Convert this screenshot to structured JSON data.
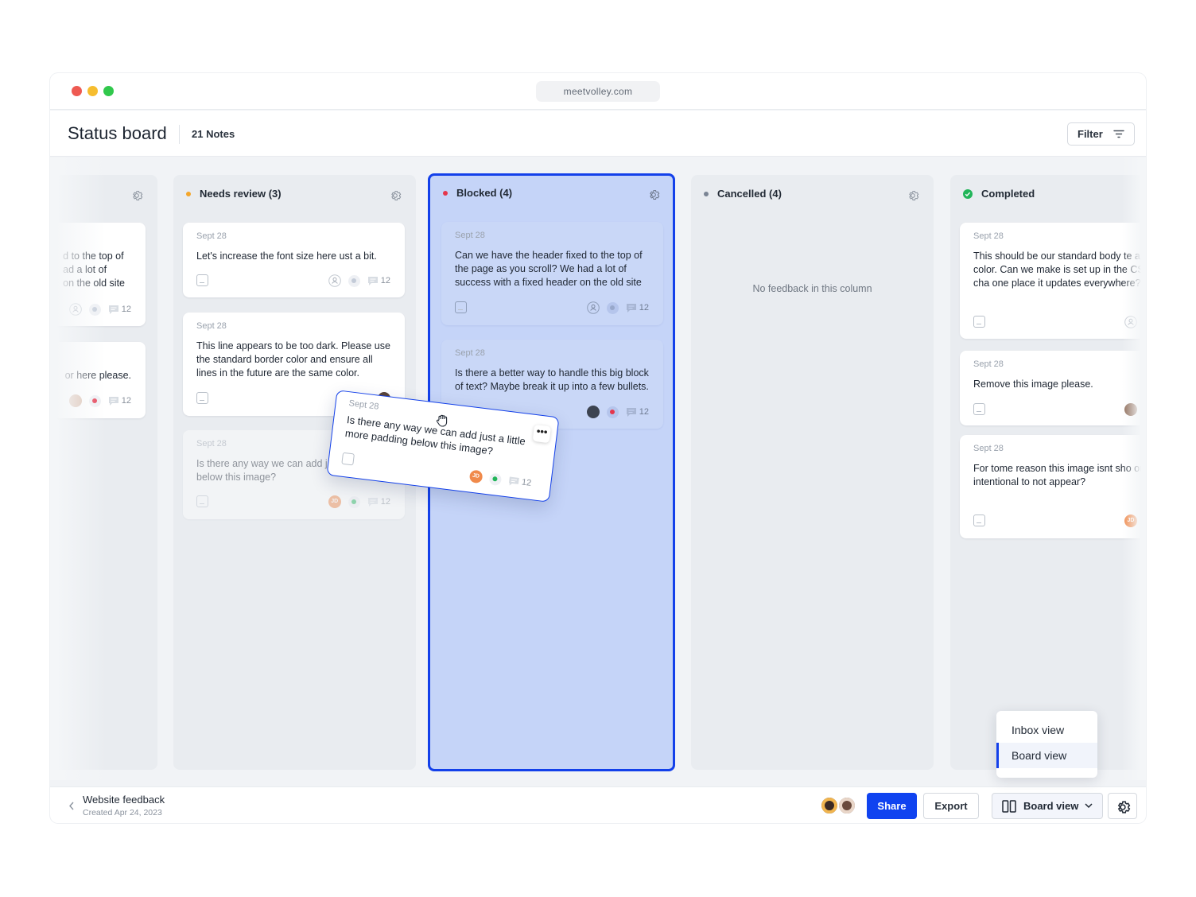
{
  "window": {
    "url": "meetvolley.com",
    "traffic_lights": [
      "#ee5a52",
      "#f6bd2f",
      "#31c84c"
    ]
  },
  "header": {
    "title": "Status board",
    "notes_count": "21 Notes",
    "filter_label": "Filter"
  },
  "columns": {
    "partial": {
      "cards": [
        {
          "lines": [
            "d to the top of",
            "ad a lot of",
            "on the old site"
          ],
          "comments": "12"
        },
        {
          "lines": [
            "or here please."
          ],
          "comments": "12"
        }
      ]
    },
    "needs_review": {
      "title": "Needs review (3)",
      "color": "#f4a62a",
      "cards": [
        {
          "date": "Sept 28",
          "text": "Let's increase the font size here ust a bit.",
          "comments": "12"
        },
        {
          "date": "Sept 28",
          "text": "This line appears to be too dark. Please use the standard border color and ensure all lines in the future are the same color.",
          "comments": "12"
        },
        {
          "date": "Sept 28",
          "text": "Is there any way we can add j padding below this image?",
          "comments": "12"
        }
      ]
    },
    "blocked": {
      "title": "Blocked (4)",
      "color": "#e5364c",
      "cards": [
        {
          "date": "Sept 28",
          "text": "Can we have the header fixed to the top of the page as you scroll? We had a lot of success with a fixed header on the old site",
          "comments": "12"
        },
        {
          "date": "Sept 28",
          "text": "Is there a better way to handle this big block of text? Maybe break it up into a few bullets.",
          "comments": "12"
        }
      ]
    },
    "cancelled": {
      "title": "Cancelled (4)",
      "color": "#7a8494",
      "empty_text": "No feedback in this column"
    },
    "completed": {
      "title": "Completed",
      "color": "#22b55a",
      "cards": [
        {
          "date": "Sept 28",
          "text": "This should be our standard body te and default text color. Can we make is set up in the CSS so that if we cha one place it updates everywhere?"
        },
        {
          "date": "Sept 28",
          "text": "Remove this image please."
        },
        {
          "date": "Sept 28",
          "text": "For tome reason this image isnt sho on mobile. Was it intentional to not appear?"
        }
      ]
    }
  },
  "dragging_card": {
    "date": "Sept 28",
    "text": "Is there any way we can add just a little more padding below this image?",
    "more": "•••",
    "avatar_initials": "JD",
    "comments": "12"
  },
  "avatar_initials": "JD",
  "footer": {
    "project_name": "Website feedback",
    "project_created": "Created Apr 24, 2023",
    "share_label": "Share",
    "export_label": "Export",
    "view_label": "Board view"
  },
  "view_menu": {
    "items": [
      "Inbox view",
      "Board view"
    ],
    "selected": "Board view"
  },
  "colors": {
    "accent": "#1340ea",
    "share": "#1043f0",
    "jd_avatar": "#f08a4b"
  }
}
